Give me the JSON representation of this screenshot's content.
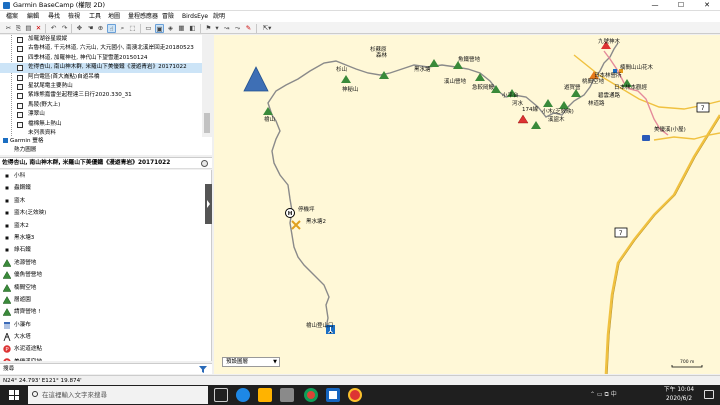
{
  "window": {
    "title": "Garmin BaseCamp (權限 2D)",
    "minimize": "—",
    "maximize": "☐",
    "close": "✕"
  },
  "menu": [
    "檔案",
    "編輯",
    "尋找",
    "檢視",
    "工具",
    "地圖",
    "量程感應器",
    "冒險",
    "BirdsEye",
    "說明"
  ],
  "search": {
    "placeholder": "搜尋",
    "button_icon": "search-icon"
  },
  "toolbar_icons": [
    "cut-icon",
    "copy-icon",
    "paste-icon",
    "delete-icon",
    "undo-icon",
    "redo-icon",
    "pan-icon",
    "selected-tool-icon",
    "zoom-icon",
    "select-icon",
    "window-icon",
    "map-icon",
    "3d-icon",
    "grid-icon",
    "profile-icon",
    "waypoint-tool-icon",
    "dropdown-icon",
    "route-tool-icon"
  ],
  "library": {
    "items": [
      {
        "label": "加羅湖谷星縱縱"
      },
      {
        "label": "古魯林道, 千元林道, 六元山, 大元國小, 南澳北溪岸回走20180523"
      },
      {
        "label": "四季林道, 加羅神社, 神代山下望雪蓮20150124"
      },
      {
        "label": "佐得杏山, 南山神木群, 米羅山下美優鐵《漫遊青岩》20171022",
        "selected": true
      },
      {
        "label": "阿白電區(首大崙點)自遊吊橋"
      },
      {
        "label": "星狀尾電主要熱山"
      },
      {
        "label": "紫綠熊嘉雷坐起程達三日行2020.330_31"
      },
      {
        "label": "馬陵(野大上)"
      },
      {
        "label": "漂翠山"
      },
      {
        "label": "檔棉無上熱山"
      },
      {
        "label": "未列表資料",
        "dots": true
      }
    ],
    "garmin_device": "Garmin 豐格",
    "garmin_sub": "熱力圖層"
  },
  "panel_title": "佐得杏山, 南山神木群, 米羅山下美優鐵《漫遊青岩》20171022",
  "list_items": [
    {
      "label": "小科",
      "icon": "dot"
    },
    {
      "label": "蟲鋼鐵",
      "icon": "dot"
    },
    {
      "label": "盜木",
      "icon": "dot"
    },
    {
      "label": "盜木(乏效映)",
      "icon": "dot"
    },
    {
      "label": "盜木2",
      "icon": "dot"
    },
    {
      "label": "黑水塘3",
      "icon": "dot"
    },
    {
      "label": "綠石鐵",
      "icon": "dot"
    },
    {
      "label": "池源營地",
      "icon": "mountain"
    },
    {
      "label": "優魚營營地",
      "icon": "mountain"
    },
    {
      "label": "楠間空地",
      "icon": "mountain"
    },
    {
      "label": "層遊園",
      "icon": "mountain"
    },
    {
      "label": "請齊營地 !",
      "icon": "mountain"
    },
    {
      "label": "小瀑布",
      "icon": "waterfall"
    },
    {
      "label": "大水塔",
      "icon": "tower"
    },
    {
      "label": "水泥道途點",
      "icon": "parking"
    },
    {
      "label": "美優溪空地",
      "icon": "parking"
    }
  ],
  "filter_label": "搜尋",
  "coordinates": "N24° 24.793' E121° 19.874'",
  "map": {
    "labels": {
      "peak_left": "杉山",
      "peak_mid": "神秘山",
      "top_pass": "杉蘇原",
      "top_forest": "森林",
      "black_water": "黑水塘",
      "stream_top": "溪山營地",
      "fishfield": "魚鐵營地",
      "ranch": "急較岡鰻",
      "small_peak": "小平台",
      "river_mark": "河水",
      "km_stone": "174線",
      "wood_a": "溪盜木",
      "wood_b": "小木(乏效映)",
      "camp_right": "遊賀營",
      "shrine": "九號神木",
      "ribbon_a": "楠間山山花木",
      "ribbon_b": "日本林本觀經",
      "trail_a": "桃間空地",
      "hut": "美優溪(小屋)",
      "wooden_peak": "檜山",
      "helipad": "停機坪",
      "black_water_2": "黑水塘2",
      "trailhead": "檜山登山口",
      "rotating_near": "碧雲通路",
      "road_a": "林道路",
      "road_b": "日本林營所"
    },
    "route_shields": [
      "7",
      "7",
      "7"
    ],
    "layer_select": "預設圖層",
    "scale": "700 m"
  },
  "taskbar": {
    "search_placeholder": "在這裡輸入文字來搜尋",
    "tray": "⌃ ▭ ⧉ 中",
    "time": "下午 10:04",
    "date": "2020/6/2"
  },
  "colors": {
    "map_bg": "#fff8d7",
    "road": "#f0c140",
    "trail": "#8a8a8a",
    "track_pink": "#e58a9a",
    "taskbar": "#1f1f1f"
  }
}
